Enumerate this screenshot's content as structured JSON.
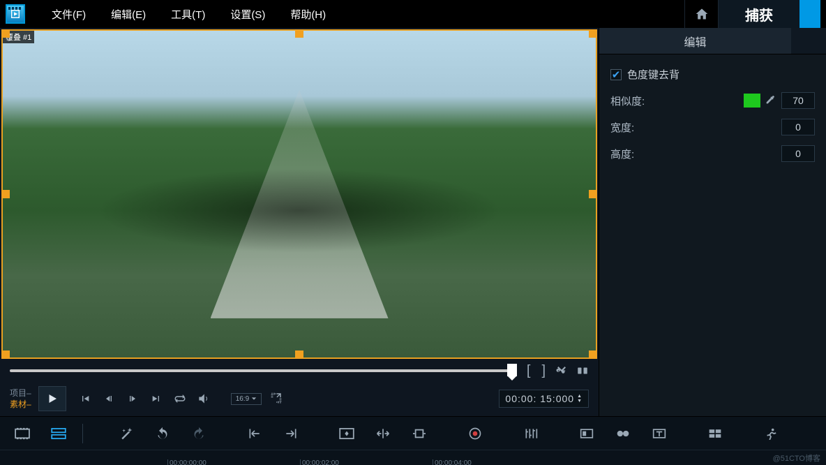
{
  "menu": {
    "items": [
      "文件(F)",
      "编辑(E)",
      "工具(T)",
      "设置(S)",
      "帮助(H)"
    ],
    "capture": "捕获"
  },
  "clip_tag": "覆叠 #1",
  "playback": {
    "mode_project": "项目–",
    "mode_clip": "素材–",
    "aspect": "16:9",
    "timecode": "00:00: 15:000"
  },
  "panel": {
    "tab_edit": "编辑",
    "chk_chroma": "色度键去背",
    "similarity_label": "相似度:",
    "similarity_value": "70",
    "width_label": "宽度:",
    "width_value": "0",
    "height_label": "高度:",
    "height_value": "0",
    "swatch_color": "#1ec81e"
  },
  "ruler": {
    "ticks": [
      "00:00:00:00",
      "00:00:02:00",
      "00:00:04:00"
    ]
  },
  "watermark": "@51CTO博客"
}
